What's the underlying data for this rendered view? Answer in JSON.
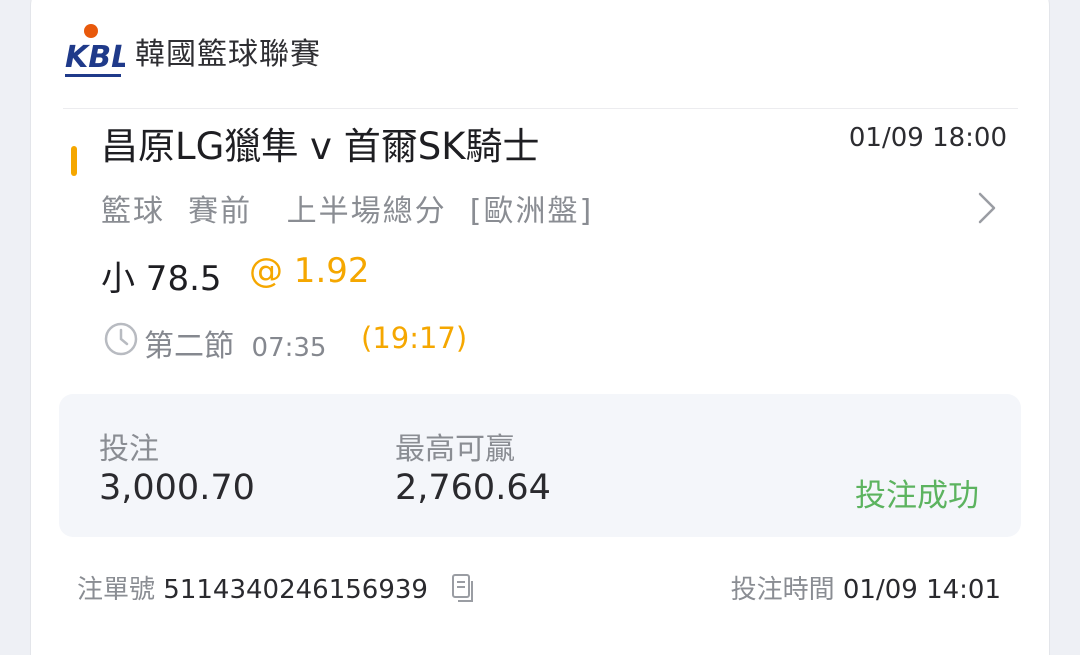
{
  "header": {
    "league_name": "韓國籃球聯賽",
    "logo_icon": "kbl-logo-icon"
  },
  "match": {
    "teams": "昌原LG獵隼 v 首爾SK騎士",
    "start_time": "01/09 18:00",
    "market": "籃球  賽前   上半場總分  [歐洲盤]",
    "selection": "小 78.5",
    "odds": "@ 1.92",
    "period": "第二節",
    "game_clock": "07:35",
    "score_time": "(19:17)"
  },
  "summary": {
    "stake_label": "投注",
    "stake_value": "3,000.70",
    "max_win_label": "最高可贏",
    "max_win_value": "2,760.64",
    "status": "投注成功"
  },
  "footer": {
    "bet_id_label": "注單號",
    "bet_id": "5114340246156939",
    "bet_time_label": "投注時間",
    "bet_time": "01/09 14:01"
  },
  "colors": {
    "accent": "#f5a700",
    "success": "#5cb35f",
    "logo_blue": "#1f3a8a",
    "logo_orange": "#e8590c"
  }
}
